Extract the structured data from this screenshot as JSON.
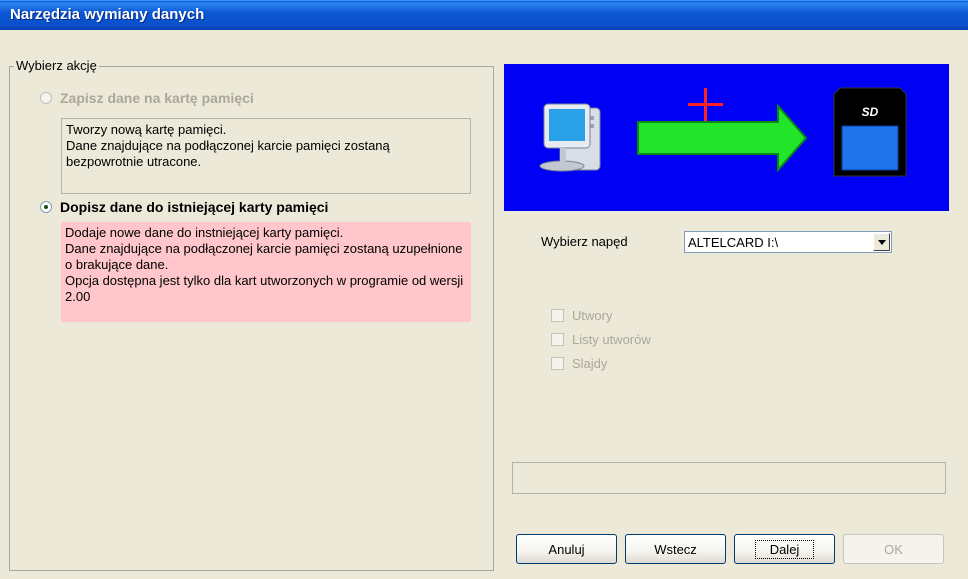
{
  "window": {
    "title": "Narzędzia wymiany danych"
  },
  "action_group": {
    "legend": "Wybierz akcję",
    "options": [
      {
        "label": "Zapisz dane na kartę pamięci",
        "checked": false,
        "enabled": false,
        "description": [
          "Tworzy nową kartę pamięci.",
          "Dane znajdujące na podłączonej karcie pamięci zostaną bezpowrotnie utracone."
        ]
      },
      {
        "label": "Dopisz dane do istniejącej karty pamięci",
        "checked": true,
        "enabled": true,
        "description": [
          "Dodaje nowe dane do instniejącej karty pamięci.",
          "Dane znajdujące na podłączonej karcie pamięci zostaną uzupełnione o brakujące dane.",
          "Opcja dostępna jest tylko dla kart utworzonych w programie od wersji 2.00"
        ]
      }
    ]
  },
  "banner": {
    "background": "#0000f5",
    "icons": [
      "computer-icon",
      "plus-icon",
      "arrow-right-icon",
      "sd-card-icon"
    ]
  },
  "drive": {
    "label": "Wybierz napęd",
    "selected": "ALTELCARD I:\\"
  },
  "checkboxes": [
    {
      "label": "Utwory",
      "checked": false,
      "enabled": false
    },
    {
      "label": "Listy utworów",
      "checked": false,
      "enabled": false
    },
    {
      "label": "Slajdy",
      "checked": false,
      "enabled": false
    }
  ],
  "buttons": {
    "cancel": "Anuluj",
    "back": "Wstecz",
    "next": "Dalej",
    "ok": "OK"
  }
}
